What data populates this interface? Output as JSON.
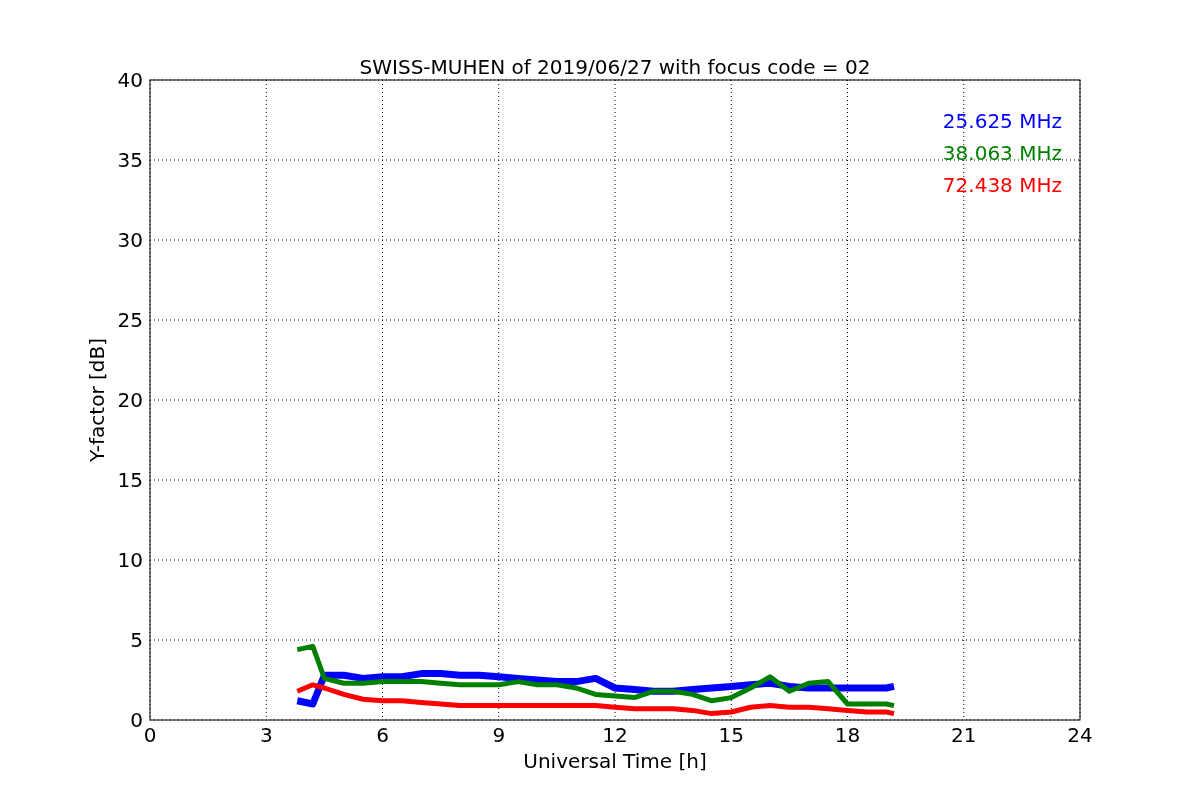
{
  "chart_data": {
    "type": "line",
    "title": "SWISS-MUHEN of 2019/06/27 with focus code = 02",
    "xlabel": "Universal Time [h]",
    "ylabel": "Y-factor [dB]",
    "x": [
      3.8,
      4.2,
      4.5,
      5,
      5.5,
      6,
      6.5,
      7,
      7.5,
      8,
      8.5,
      9,
      9.5,
      10,
      10.5,
      11,
      11.5,
      12,
      12.5,
      13,
      13.5,
      14,
      14.5,
      15,
      15.5,
      16,
      16.5,
      17,
      17.5,
      18,
      18.5,
      19,
      19.2
    ],
    "series": [
      {
        "name": "25.625 MHz",
        "color": "#0000ff",
        "values": [
          1.2,
          1.0,
          2.8,
          2.8,
          2.6,
          2.7,
          2.7,
          2.9,
          2.9,
          2.8,
          2.8,
          2.7,
          2.6,
          2.5,
          2.4,
          2.4,
          2.6,
          2.0,
          1.9,
          1.8,
          1.8,
          1.9,
          2.0,
          2.1,
          2.2,
          2.3,
          2.1,
          2.0,
          2.0,
          2.0,
          2.0,
          2.0,
          2.1
        ]
      },
      {
        "name": "38.063 MHz",
        "color": "#008000",
        "values": [
          4.4,
          4.6,
          2.6,
          2.3,
          2.3,
          2.4,
          2.4,
          2.4,
          2.3,
          2.2,
          2.2,
          2.2,
          2.4,
          2.2,
          2.2,
          2.0,
          1.6,
          1.5,
          1.4,
          1.8,
          1.8,
          1.6,
          1.2,
          1.4,
          2.0,
          2.7,
          1.8,
          2.3,
          2.4,
          1.0,
          1.0,
          1.0,
          0.9
        ]
      },
      {
        "name": "72.438 MHz",
        "color": "#ff0000",
        "values": [
          1.8,
          2.2,
          2.0,
          1.6,
          1.3,
          1.2,
          1.2,
          1.1,
          1.0,
          0.9,
          0.9,
          0.9,
          0.9,
          0.9,
          0.9,
          0.9,
          0.9,
          0.8,
          0.7,
          0.7,
          0.7,
          0.6,
          0.4,
          0.5,
          0.8,
          0.9,
          0.8,
          0.8,
          0.7,
          0.6,
          0.5,
          0.5,
          0.4
        ]
      }
    ],
    "xlim": [
      0,
      24
    ],
    "ylim": [
      0,
      40
    ],
    "xticks": [
      0,
      3,
      6,
      9,
      12,
      15,
      18,
      21,
      24
    ],
    "yticks": [
      0,
      5,
      10,
      15,
      20,
      25,
      30,
      35,
      40
    ],
    "grid": true
  }
}
